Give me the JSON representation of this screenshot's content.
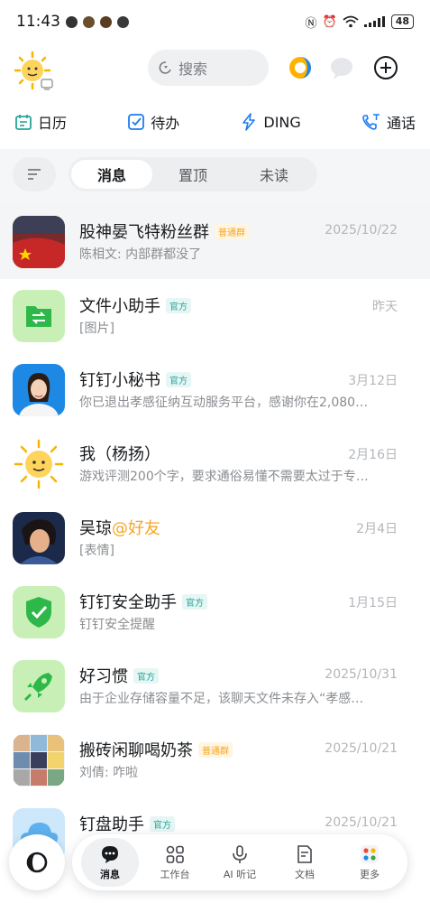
{
  "status_bar": {
    "time": "11:43",
    "battery": "48"
  },
  "header": {
    "search_placeholder": "搜索"
  },
  "quick_actions": [
    {
      "label": "日历",
      "icon": "calendar-icon"
    },
    {
      "label": "待办",
      "icon": "checkbox-icon"
    },
    {
      "label": "DING",
      "icon": "lightning-icon"
    },
    {
      "label": "通话",
      "icon": "phone-icon"
    }
  ],
  "tabs": [
    {
      "label": "消息",
      "active": true
    },
    {
      "label": "置顶",
      "active": false
    },
    {
      "label": "未读",
      "active": false
    }
  ],
  "conversations": [
    {
      "title": "股神晏飞特粉丝群",
      "tag": "普通群",
      "tag_type": "group",
      "subtitle": "陈相文: 内部群都没了",
      "time": "2025/10/22"
    },
    {
      "title": "文件小助手",
      "tag": "官方",
      "tag_type": "official",
      "subtitle": "[图片]",
      "time": "昨天"
    },
    {
      "title": "钉钉小秘书",
      "tag": "官方",
      "tag_type": "official",
      "subtitle": "你已退出孝感征纳互动服务平台，感谢你在2,080…",
      "time": "3月12日"
    },
    {
      "title": "我（杨扬）",
      "tag": "",
      "tag_type": "",
      "subtitle": "游戏评测200个字，要求通俗易懂不需要太过于专…",
      "time": "2月16日"
    },
    {
      "title": "吴琼",
      "mention": "@好友",
      "tag": "",
      "tag_type": "",
      "subtitle": "[表情]",
      "time": "2月4日"
    },
    {
      "title": "钉钉安全助手",
      "tag": "官方",
      "tag_type": "official",
      "subtitle": "钉钉安全提醒",
      "time": "1月15日"
    },
    {
      "title": "好习惯",
      "tag": "官方",
      "tag_type": "official",
      "subtitle": "由于企业存储容量不足，该聊天文件未存入“孝感…",
      "time": "2025/10/31"
    },
    {
      "title": "搬砖闲聊喝奶茶",
      "tag": "普通群",
      "tag_type": "group",
      "subtitle": "刘倩: 咋啦",
      "time": "2025/10/21"
    },
    {
      "title": "钉盘助手",
      "tag": "官方",
      "tag_type": "official",
      "subtitle": "",
      "time": "2025/10/21"
    }
  ],
  "bottom_nav": [
    {
      "label": "消息",
      "icon": "chat-icon",
      "active": true
    },
    {
      "label": "工作台",
      "icon": "grid-icon",
      "active": false
    },
    {
      "label": "AI 听记",
      "icon": "microphone-icon",
      "active": false
    },
    {
      "label": "文档",
      "icon": "document-icon",
      "active": false
    },
    {
      "label": "更多",
      "icon": "more-apps-icon",
      "active": false
    }
  ],
  "colors": {
    "accent": "#1e7cf2",
    "official_tag": "#26a69a",
    "group_tag": "#f5a623"
  }
}
